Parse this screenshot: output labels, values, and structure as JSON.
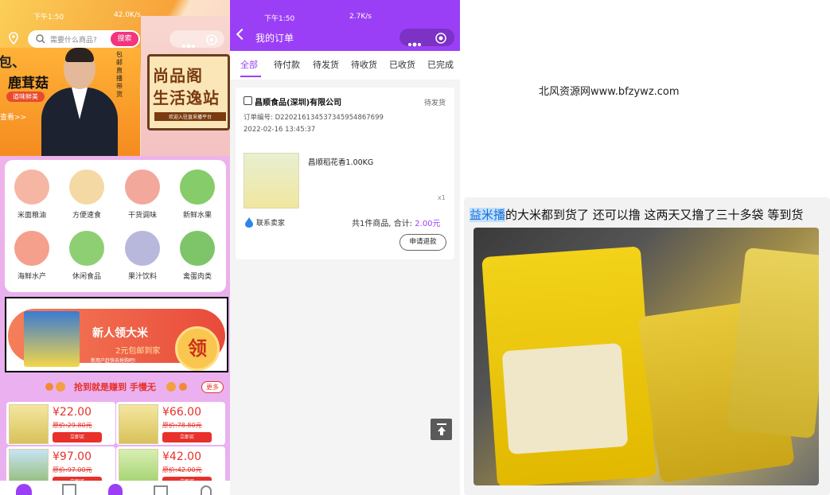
{
  "left_app": {
    "status_time": "下午1:50",
    "status_net": "42.0K/s",
    "search_placeholder": "需要什么商品?",
    "search_button": "搜索",
    "banner_left": {
      "line1": "包、",
      "line2": "鹿茸菇",
      "tag": "道味鲜美",
      "more": "查看>>",
      "vertical": "包邮 直播带货"
    },
    "banner_right": {
      "line1": "尚品阁",
      "line2": "生活逸站",
      "sub": "欢迎入驻直采播平台"
    },
    "categories": [
      {
        "label": "米面粮油",
        "color": "#f6b6a4"
      },
      {
        "label": "方便速食",
        "color": "#f5d9a4"
      },
      {
        "label": "干货调味",
        "color": "#f3a89c"
      },
      {
        "label": "新鲜水果",
        "color": "#86cc6a"
      },
      {
        "label": "海鲜水产",
        "color": "#f4a08c"
      },
      {
        "label": "休闲食品",
        "color": "#8fcf74"
      },
      {
        "label": "果汁饮料",
        "color": "#b7b8dc"
      },
      {
        "label": "禽蛋肉类",
        "color": "#7ec56a"
      }
    ],
    "promo": {
      "title": "新人领大米",
      "subtitle": "2元包邮到家",
      "note": "新用户赶快去抢购吧!",
      "button": "领"
    },
    "hot_title": "抢到就是赚到 手慢无",
    "hot_more": "更多",
    "products": [
      {
        "price": "¥22.00",
        "old": "原价:29.80元",
        "buy": "立即买"
      },
      {
        "price": "¥66.00",
        "old": "原价:78.80元",
        "buy": "立即买"
      },
      {
        "price": "¥97.00",
        "old": "原价:97.00元",
        "buy": "立即买"
      },
      {
        "price": "¥42.00",
        "old": "原价:42.00元",
        "buy": "立即买"
      }
    ]
  },
  "orders_app": {
    "status_time": "下午1:50",
    "status_net": "2.7K/s",
    "title": "我的订单",
    "tabs": [
      "全部",
      "待付款",
      "待发货",
      "待收货",
      "已收货",
      "已完成"
    ],
    "active_tab": 0,
    "order": {
      "shop": "昌顺食品(深圳)有限公司",
      "status": "待发货",
      "number": "订单编号: D2202161345373459548676​99",
      "date": "2022-02-16 13:45:37",
      "goods_name": "昌顺稻花香1.00KG",
      "qty": "x1",
      "contact": "联系卖家",
      "summary_prefix": "共1件商品, 合计:",
      "total": "2.00元",
      "refund": "申请退款"
    },
    "accent": "#9b3ff6"
  },
  "watermark": "北风资源网www.bfzywz.com",
  "chat": {
    "highlight": "益米播",
    "text": "的大米都到货了  还可以撸  这两天又撸了三十多袋 等到货"
  }
}
